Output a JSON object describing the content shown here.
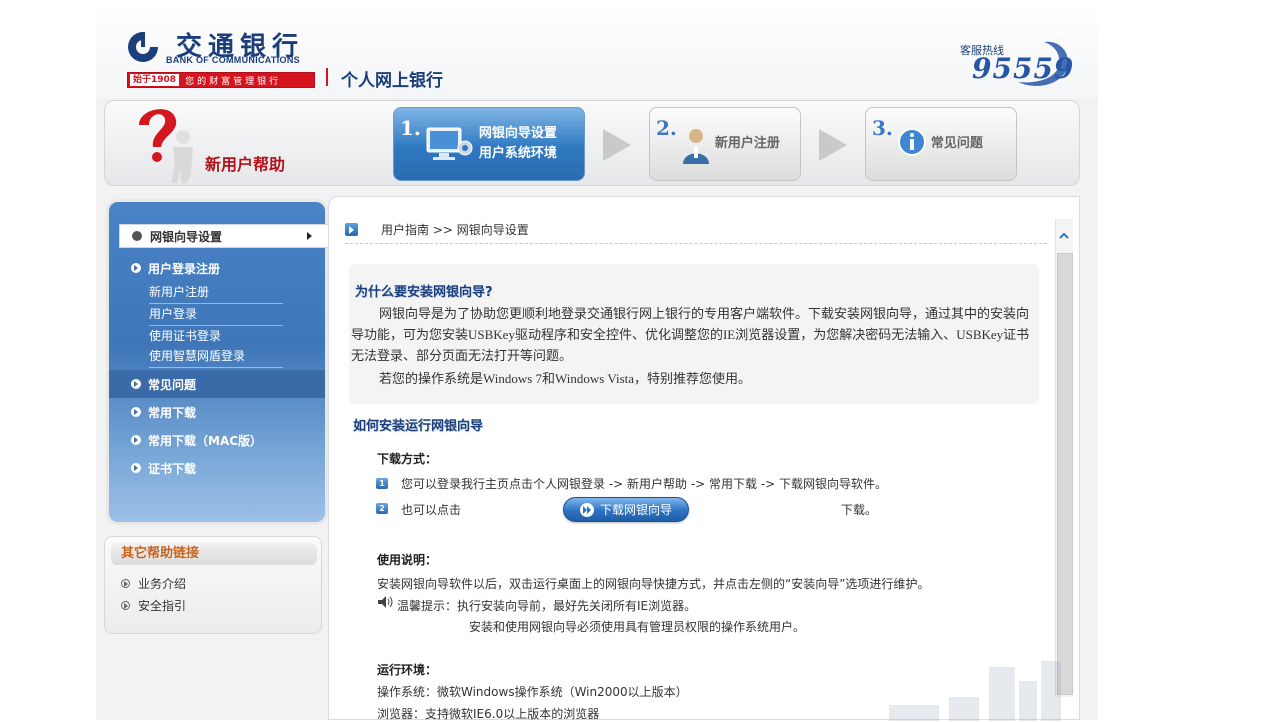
{
  "header": {
    "bank_name_cn": "交通银行",
    "bank_name_en": "BANK OF COMMUNICATIONS",
    "slogan_year": "始于1908",
    "slogan_text": "您的财富管理银行",
    "product_title": "个人网上银行",
    "hotline_label": "客服热线",
    "hotline_number": "95559"
  },
  "steps_bar": {
    "help_title": "新用户帮助",
    "steps": [
      {
        "number": "1.",
        "line1": "网银向导设置",
        "line2": "用户系统环境",
        "active": true
      },
      {
        "number": "2.",
        "line1": "新用户注册",
        "active": false
      },
      {
        "number": "3.",
        "line1": "常见问题",
        "active": false
      }
    ]
  },
  "sidebar": {
    "active_item": "网银向导设置",
    "items": [
      {
        "label": "用户登录注册",
        "subitems": [
          "新用户注册",
          "用户登录",
          "使用证书登录",
          "使用智慧网盾登录"
        ]
      },
      {
        "label": "常见问题"
      },
      {
        "label": "常用下载"
      },
      {
        "label": "常用下载（MAC版）"
      },
      {
        "label": "证书下载"
      }
    ]
  },
  "help_links": {
    "title": "其它帮助链接",
    "links": [
      "业务介绍",
      "安全指引"
    ]
  },
  "content": {
    "breadcrumb": "用户指南 >> 网银向导设置",
    "why_title": "为什么要安装网银向导?",
    "why_para1": "网银向导是为了协助您更顺利地登录交通银行网上银行的专用客户端软件。下载安装网银向导，通过其中的安装向导功能，可为您安装USBKey驱动程序和安全控件、优化调整您的IE浏览器设置，为您解决密码无法输入、USBKey证书无法登录、部分页面无法打开等问题。",
    "why_para2": "若您的操作系统是Windows 7和Windows Vista，特别推荐您使用。",
    "how_title": "如何安装运行网银向导",
    "download_heading": "下载方式：",
    "download_item1": "您可以登录我行主页点击个人网银登录 -> 新用户帮助 -> 常用下载 -> 下载网银向导软件。",
    "download_item2_prefix": "也可以点击",
    "download_button": "下载网银向导",
    "download_item2_suffix": "下载。",
    "usage_heading": "使用说明：",
    "usage_line": "安装网银向导软件以后，双击运行桌面上的网银向导快捷方式，并点击左侧的“安装向导”选项进行维护。",
    "tip_line1": "温馨提示：执行安装向导前，最好先关闭所有IE浏览器。",
    "tip_line2": "安装和使用网银向导必须使用具有管理员权限的操作系统用户。",
    "env_heading": "运行环境：",
    "env_os": "操作系统：微软Windows操作系统（Win2000以上版本）",
    "env_browser": "浏览器：支持微软IE6.0以上版本的浏览器"
  },
  "colors": {
    "brand_blue": "#1c3f7b",
    "brand_red": "#d6141f",
    "nav_blue": "#3e76b8"
  }
}
